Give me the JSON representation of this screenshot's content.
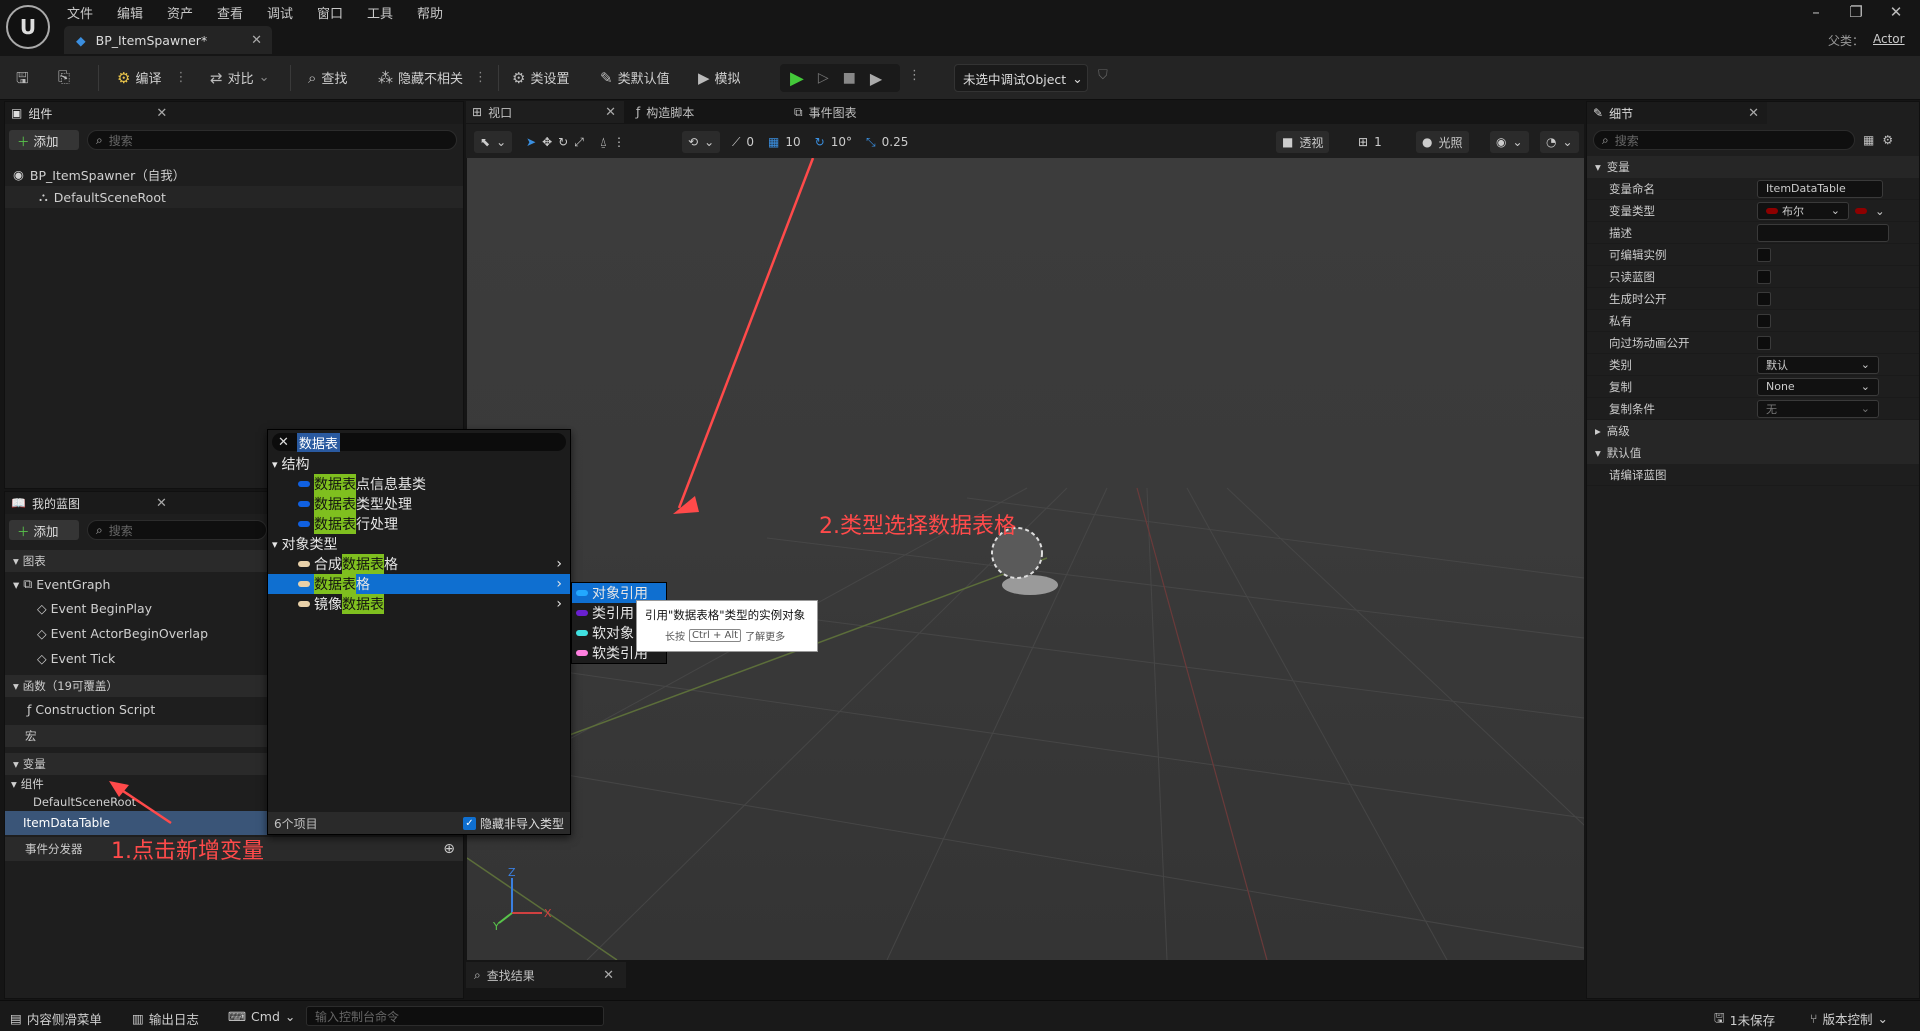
{
  "menu": [
    "文件",
    "编辑",
    "资产",
    "查看",
    "调试",
    "窗口",
    "工具",
    "帮助"
  ],
  "doc_tab": {
    "title": "BP_ItemSpawner*"
  },
  "parent": {
    "label": "父类：",
    "value": "Actor"
  },
  "toolbar": {
    "compile": "编译",
    "diff": "对比",
    "find": "查找",
    "hide_unrelated": "隐藏不相关",
    "class_settings": "类设置",
    "class_defaults": "类默认值",
    "simulate": "模拟",
    "debug_object": "未选中调试Object"
  },
  "components_panel": {
    "title": "组件",
    "add": "添加",
    "search_placeholder": "搜索",
    "items": [
      "BP_ItemSpawner（自我）",
      "DefaultSceneRoot"
    ]
  },
  "my_blueprint": {
    "title": "我的蓝图",
    "add": "添加",
    "search_placeholder": "搜索",
    "graphs_header": "图表",
    "event_graph": "EventGraph",
    "events": [
      "Event BeginPlay",
      "Event ActorBeginOverlap",
      "Event Tick"
    ],
    "functions_header": "函数（19可覆盖）",
    "construction": "Construction Script",
    "macros_header": "宏",
    "variables_header": "变量",
    "components_group": "组件",
    "component_var": "DefaultSceneRoot",
    "selected_var": {
      "name": "ItemDataTable",
      "type": "布尔"
    },
    "dispatchers_header": "事件分发器"
  },
  "center_tabs": [
    "视口",
    "构造脚本",
    "事件图表"
  ],
  "viewport_toolbar": {
    "snap_rot": "0",
    "grid": "10",
    "angle": "10°",
    "scale": "0.25",
    "view": "透视",
    "speed": "1",
    "lit": "光照"
  },
  "find_results": "查找结果",
  "popup": {
    "search_value": "数据表",
    "structure_header": "结构",
    "structures": [
      {
        "hl": "数据表",
        "rest": "点信息基类"
      },
      {
        "hl": "数据表",
        "rest": "类型处理"
      },
      {
        "hl": "数据表",
        "rest": "行处理"
      }
    ],
    "object_header": "对象类型",
    "objects": [
      {
        "pre": "合成",
        "hl": "数据表",
        "post": "格"
      },
      {
        "pre": "",
        "hl": "数据表",
        "post": "格"
      },
      {
        "pre": "镜像",
        "hl": "数据表",
        "post": ""
      }
    ],
    "footer_count": "6个项目",
    "hide_label": "隐藏非导入类型"
  },
  "submenu": [
    "对象引用",
    "类引用",
    "软对象",
    "软类引用"
  ],
  "tooltip": {
    "text": "引用\"数据表格\"类型的实例对象",
    "hold": "长按",
    "keys": "Ctrl + Alt",
    "learn": "了解更多"
  },
  "annotations": {
    "step1": "1.点击新增变量",
    "step2": "2.类型选择数据表格"
  },
  "details": {
    "title": "细节",
    "search_placeholder": "搜索",
    "variables_header": "变量",
    "rows": [
      {
        "label": "变量命名",
        "value": "ItemDataTable"
      },
      {
        "label": "变量类型",
        "value": "布尔"
      },
      {
        "label": "描述",
        "value": ""
      },
      {
        "label": "可编辑实例"
      },
      {
        "label": "只读蓝图"
      },
      {
        "label": "生成时公开"
      },
      {
        "label": "私有"
      },
      {
        "label": "向过场动画公开"
      },
      {
        "label": "类别",
        "value": "默认"
      },
      {
        "label": "复制",
        "value": "None"
      },
      {
        "label": "复制条件",
        "value": "无"
      }
    ],
    "advanced": "高级",
    "default_header": "默认值",
    "compile_hint": "请编译蓝图"
  },
  "statusbar": {
    "content_drawer": "内容侧滑菜单",
    "output_log": "输出日志",
    "cmd": "Cmd",
    "console_placeholder": "输入控制台命令",
    "unsaved": "1未保存",
    "source_control": "版本控制"
  },
  "colors": {
    "accent": "#0f6fd0",
    "highlight": "#7fbf1f",
    "annotation": "#ff4a4a",
    "bool_pin": "#8e0000"
  }
}
